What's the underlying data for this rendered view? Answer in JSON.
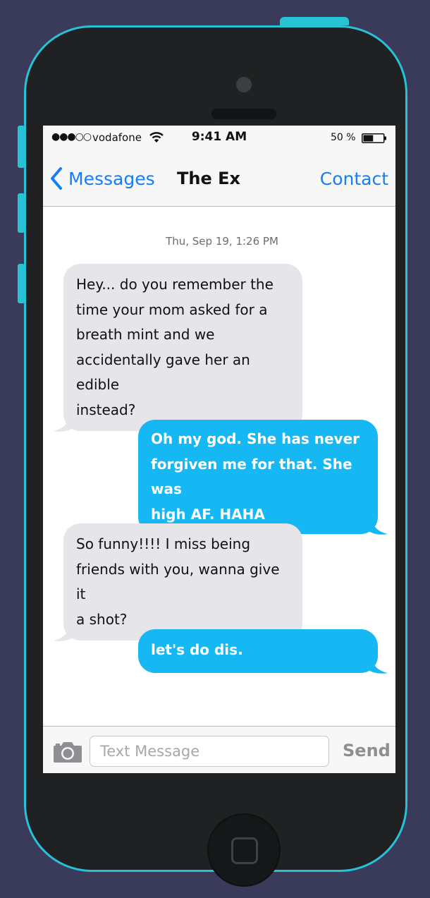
{
  "status_bar": {
    "signal": "●●●○○",
    "carrier": "vodafone",
    "time": "9:41 AM",
    "battery_percent": "50 %",
    "battery_level": 0.5
  },
  "nav": {
    "back_label": "Messages",
    "title": "The Ex",
    "contact_label": "Contact"
  },
  "conversation": {
    "timestamp": "Thu, Sep 19, 1:26 PM",
    "messages": [
      {
        "direction": "incoming",
        "lines": [
          "Hey... do you remember the",
          "time your mom asked for a",
          "breath mint and we",
          "accidentally gave her an edible",
          "instead?"
        ]
      },
      {
        "direction": "outgoing",
        "lines": [
          "Oh my god. She has never",
          "forgiven me for that. She was",
          "high AF. HAHA"
        ]
      },
      {
        "direction": "incoming",
        "lines": [
          "So funny!!!! I miss being",
          "friends with you, wanna give it",
          "a shot?"
        ]
      },
      {
        "direction": "outgoing",
        "lines": [
          "let's do dis."
        ]
      }
    ]
  },
  "composer": {
    "placeholder": "Text Message",
    "send_label": "Send"
  },
  "colors": {
    "accent": "#157efb",
    "outgoing_bubble": "#16b8f3",
    "incoming_bubble": "#e5e5ea",
    "phone_trim": "#27c2d6"
  },
  "icons": [
    "wifi-icon",
    "battery-icon",
    "chevron-left-icon",
    "camera-icon",
    "home-button-icon"
  ]
}
